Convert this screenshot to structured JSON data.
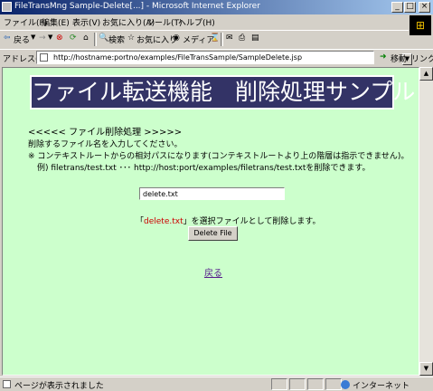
{
  "window": {
    "title": "FileTransMng Sample-Delete[...] - Microsoft Internet Explorer",
    "controls": [
      "_",
      "□",
      "×"
    ]
  },
  "menu": [
    "ファイル(F)",
    "編集(E)",
    "表示(V)",
    "お気に入り(A)",
    "ツール(T)",
    "ヘルプ(H)"
  ],
  "toolbar": {
    "back": "戻る",
    "forward": "→",
    "stop": "⊗",
    "refresh": "⟳",
    "home": "⌂",
    "search": "検索",
    "favorites": "お気に入り",
    "media": "メディア",
    "history": "⌛",
    "mail": "✉",
    "print": "⎙",
    "edit": "▤"
  },
  "address": {
    "label": "アドレス(D)",
    "url": "http://hostname:portno/examples/FileTransSample/SampleDelete.jsp",
    "go": "移動",
    "links": "リンク »"
  },
  "page": {
    "banner": "ファイル転送機能　削除処理サンプル",
    "section": "<<<<<  ファイル削除処理  >>>>>",
    "instruction": "削除するファイル名を入力してください。",
    "note": "※ コンテキストルートからの相対パスになります(コンテキストルートより上の階層は指示できません)。",
    "example": "例) filetrans/test.txt ･･･ http://host:port/examples/filetrans/test.txtを削除できます。",
    "input_value": "delete.txt",
    "confirm_open": "「",
    "confirm_file": "delete.txt",
    "confirm_rest": "」を選択ファイルとして削除します。",
    "delete_button": "Delete File",
    "back_link": "戻る"
  },
  "status": {
    "text": "ページが表示されました",
    "zone": "インターネット"
  }
}
